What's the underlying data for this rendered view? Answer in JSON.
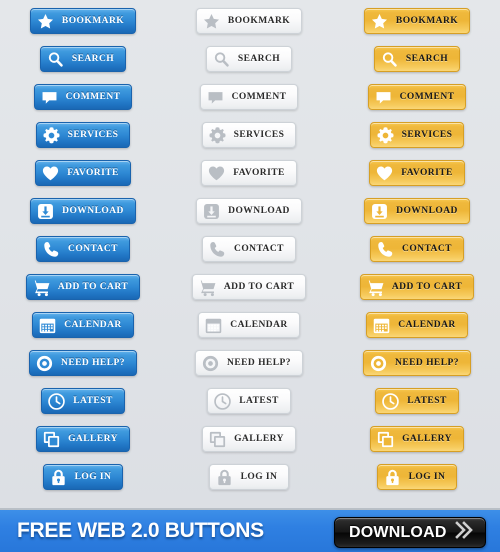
{
  "background_color": "#e2e5e9",
  "columns": [
    {
      "name": "blue",
      "style_label": "blue",
      "accent": "#2f8ad5"
    },
    {
      "name": "white",
      "style_label": "white",
      "accent": "#eef0f2"
    },
    {
      "name": "yellow",
      "style_label": "yellow",
      "accent": "#eeb637"
    }
  ],
  "buttons": [
    {
      "label": "BOOKMARK",
      "icon": "star-icon"
    },
    {
      "label": "SEARCH",
      "icon": "search-icon"
    },
    {
      "label": "COMMENT",
      "icon": "comment-icon"
    },
    {
      "label": "SERVICES",
      "icon": "gear-icon"
    },
    {
      "label": "FAVORITE",
      "icon": "heart-icon"
    },
    {
      "label": "DOWNLOAD",
      "icon": "download-icon"
    },
    {
      "label": "CONTACT",
      "icon": "phone-icon"
    },
    {
      "label": "ADD TO CART",
      "icon": "cart-icon"
    },
    {
      "label": "CALENDAR",
      "icon": "calendar-icon"
    },
    {
      "label": "NEED HELP?",
      "icon": "lifering-icon"
    },
    {
      "label": "LATEST",
      "icon": "clock-icon"
    },
    {
      "label": "GALLERY",
      "icon": "gallery-icon"
    },
    {
      "label": "LOG IN",
      "icon": "lock-icon"
    }
  ],
  "footer": {
    "title": "FREE WEB 2.0 BUTTONS",
    "background_color": "#2f80e2",
    "download": {
      "label": "DOWNLOAD",
      "icon": "double-chevron-right-icon",
      "background_color": "#161616"
    }
  }
}
